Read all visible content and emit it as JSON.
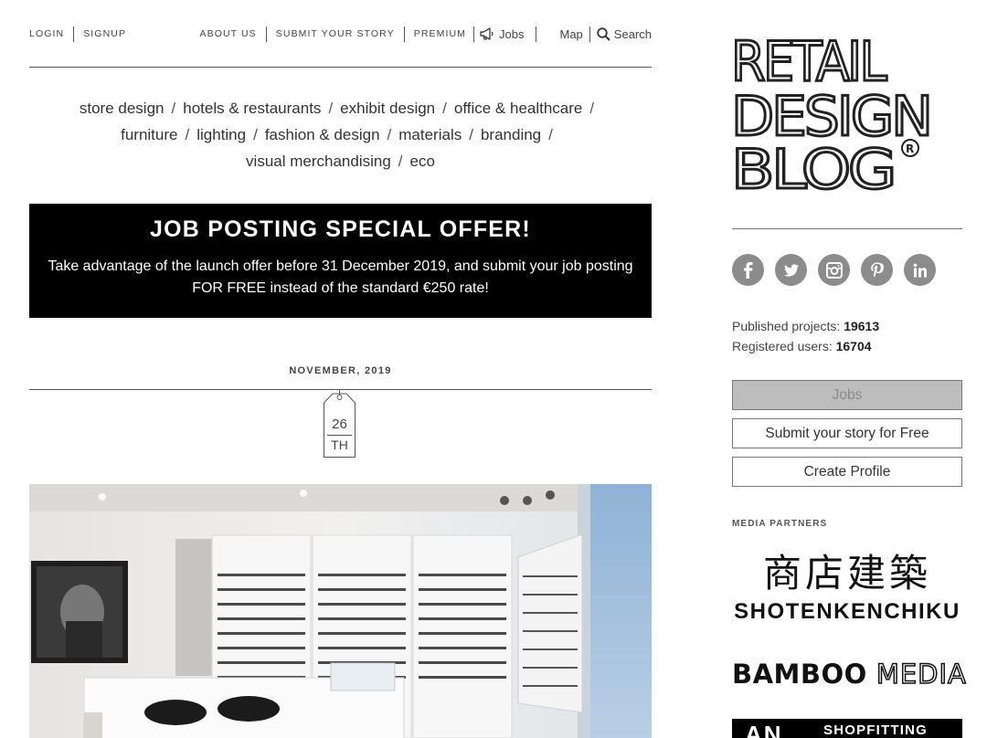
{
  "topnav": {
    "login": "LOGIN",
    "signup": "SIGNUP",
    "about": "ABOUT US",
    "submit_story": "SUBMIT YOUR STORY",
    "premium": "PREMIUM",
    "jobs": "Jobs",
    "map": "Map",
    "search": "Search"
  },
  "categories": [
    "store design",
    "hotels & restaurants",
    "exhibit design",
    "office & healthcare",
    "furniture",
    "lighting",
    "fashion & design",
    "materials",
    "branding",
    "visual merchandising",
    "eco"
  ],
  "offer": {
    "title": "JOB POSTING SPECIAL OFFER!",
    "text": "Take advantage of the launch offer before 31 December 2019, and submit your job posting FOR FREE instead of the standard €250 rate!"
  },
  "post_date": {
    "month": "NOVEMBER, 2019",
    "day": "26",
    "suffix": "TH"
  },
  "sidebar": {
    "logo": {
      "line1": "RETAIL",
      "line2": "DESIGN",
      "line3": "BLOG"
    },
    "socials": [
      "facebook-icon",
      "twitter-icon",
      "instagram-icon",
      "pinterest-icon",
      "linkedin-icon"
    ],
    "stats": {
      "published_label": "Published projects:",
      "published_value": "19613",
      "registered_label": "Registered users:",
      "registered_value": "16704"
    },
    "buttons": {
      "jobs": "Jobs",
      "submit": "Submit your story for Free",
      "profile": "Create Profile"
    },
    "media_partners_title": "MEDIA PARTNERS",
    "partners": {
      "shoten_kanji": "商店建築",
      "shoten_latin": "SHOTENKENCHIKU",
      "bamboo": "BAMBOO",
      "media": "MEDIA",
      "shopfitting": "SHOPFITTING"
    }
  },
  "colors": {
    "banner_bg": "#000000",
    "icon_grey": "#8c8c8c",
    "jobs_button_bg": "#bdbdbd"
  }
}
